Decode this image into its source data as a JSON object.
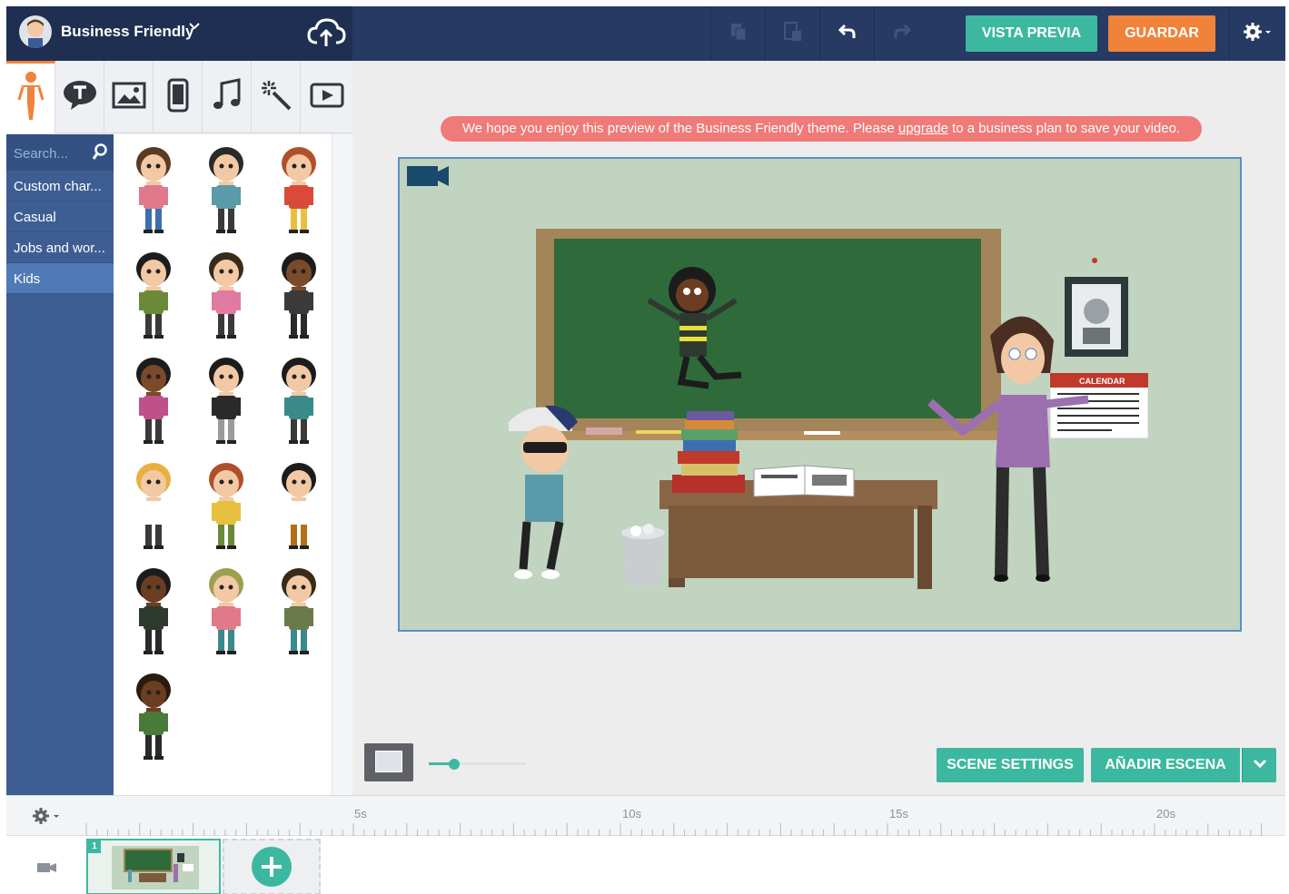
{
  "app": {
    "theme_name": "Business Friendly",
    "preview_label": "VISTA PREVIA",
    "save_label": "GUARDAR"
  },
  "toolbar_icons": [
    "copy-icon",
    "paste-icon",
    "undo-icon",
    "redo-icon",
    "settings-icon"
  ],
  "tool_tabs": [
    "characters-tab",
    "text-tab",
    "image-tab",
    "device-tab",
    "music-tab",
    "effects-tab",
    "video-tab"
  ],
  "sidebar": {
    "search_placeholder": "Search...",
    "categories": [
      {
        "label": "Custom char..."
      },
      {
        "label": "Casual"
      },
      {
        "label": "Jobs and wor..."
      },
      {
        "label": "Kids",
        "active": true
      }
    ]
  },
  "banner": {
    "text_before": "We hope you enjoy this preview of the Business Friendly theme. Please ",
    "link": "upgrade",
    "text_after": " to a business plan to save your video."
  },
  "scene": {
    "calendar_label": "CALENDAR"
  },
  "bottom": {
    "scene_settings_label": "SCENE SETTINGS",
    "add_scene_label": "AÑADIR ESCENA"
  },
  "timeline": {
    "ticks": [
      "5s",
      "10s",
      "15s",
      "20s"
    ],
    "clip_number": "1"
  },
  "colors": {
    "teal": "#3db8a0",
    "orange": "#f1823a",
    "navy": "#273a63",
    "sidebar_blue": "#3e5e93",
    "banner_red": "#f07a78"
  }
}
